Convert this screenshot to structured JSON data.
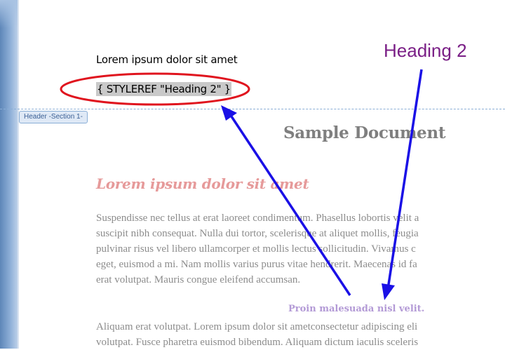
{
  "header": {
    "text": "Lorem ipsum dolor sit amet",
    "field_code": "{ STYLEREF \"Heading 2\" }",
    "section_tag": "Header -Section 1-"
  },
  "document": {
    "title": "Sample Document",
    "heading1": "Lorem ipsum dolor sit amet",
    "paragraph1": [
      "Suspendisse nec tellus at erat laoreet condimentum. Phasellus lobortis velit a",
      "suscipit nibh consequat. Nulla dui tortor, scelerisque at aliquet mollis, feugia",
      " pulvinar risus vel libero ullamcorper et mollis lectus sollicitudin. Vivamus c",
      "eget, euismod a mi. Nam mollis varius purus vitae hendrerit. Maecenas id fa",
      "erat volutpat. Mauris congue eleifend  accumsan."
    ],
    "heading2": "Proin malesuada nisl velit.",
    "paragraph2": [
      "Aliquam erat volutpat. Lorem ipsum dolor sit ametconsectetur adipiscing eli",
      "volutpat. Fusce pharetra euismod bibendum. Aliquam dictum iaculis sceleris"
    ]
  },
  "annotation": {
    "callout_label": "Heading 2",
    "ellipse_color": "#e0141e",
    "arrow_color": "#1a10e6",
    "callout_color": "#7a1f86"
  }
}
